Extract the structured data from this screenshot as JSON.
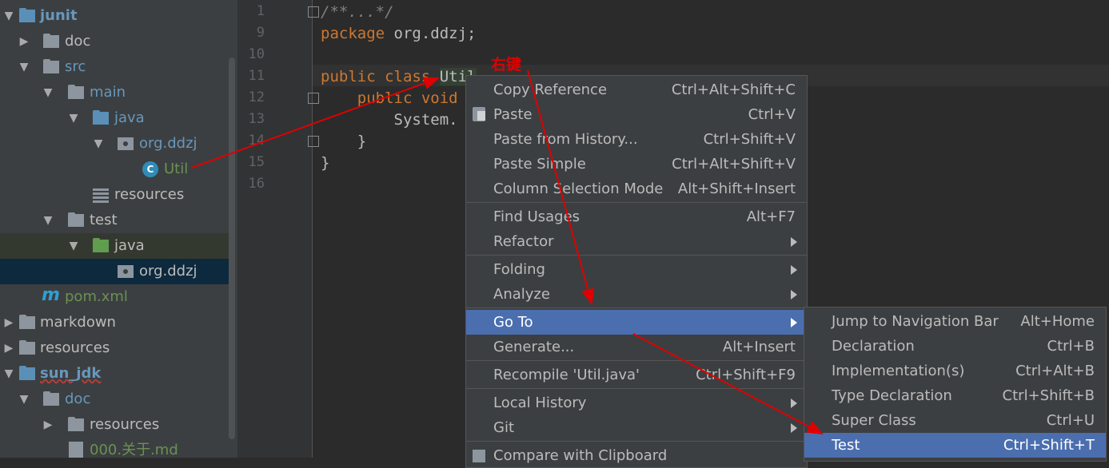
{
  "project_tree": {
    "items": [
      {
        "label": "junit",
        "icon": "folder-icon"
      },
      {
        "label": "doc",
        "icon": "folder-icon"
      },
      {
        "label": "src",
        "icon": "folder-icon"
      },
      {
        "label": "main",
        "icon": "folder-icon"
      },
      {
        "label": "java",
        "icon": "folder-icon"
      },
      {
        "label": "org.ddzj",
        "icon": "package-icon"
      },
      {
        "label": "Util",
        "icon": "class-icon"
      },
      {
        "label": "resources",
        "icon": "resources-folder-icon"
      },
      {
        "label": "test",
        "icon": "folder-icon"
      },
      {
        "label": "java",
        "icon": "folder-icon"
      },
      {
        "label": "org.ddzj",
        "icon": "package-icon"
      },
      {
        "label": "pom.xml",
        "icon": "maven-icon"
      },
      {
        "label": "markdown",
        "icon": "folder-icon"
      },
      {
        "label": "resources",
        "icon": "folder-icon"
      },
      {
        "label": "sun_jdk",
        "icon": "folder-icon"
      },
      {
        "label": "doc",
        "icon": "folder-icon"
      },
      {
        "label": "resources",
        "icon": "folder-icon"
      },
      {
        "label": "000.关于.md",
        "icon": "markdown-file-icon"
      }
    ]
  },
  "editor": {
    "line_numbers": [
      "1",
      "9",
      "10",
      "11",
      "12",
      "13",
      "14",
      "15",
      "16"
    ],
    "code": {
      "comment": "/**...*/",
      "package_kw": "package",
      "package_name": " org.ddzj;",
      "public_kw": "public",
      "class_kw": "class",
      "class_name": "Util",
      "public_void": "public void",
      "system": "System.",
      "brace_inner": "}",
      "brace_outer": "}"
    }
  },
  "annotation": {
    "text": "右键",
    "color": "#e00000"
  },
  "context_menu": {
    "items": [
      {
        "label": "Copy Reference",
        "shortcut": "Ctrl+Alt+Shift+C"
      },
      {
        "label": "Paste",
        "shortcut": "Ctrl+V",
        "icon": "paste-icon"
      },
      {
        "label": "Paste from History...",
        "shortcut": "Ctrl+Shift+V"
      },
      {
        "label": "Paste Simple",
        "shortcut": "Ctrl+Alt+Shift+V"
      },
      {
        "label": "Column Selection Mode",
        "shortcut": "Alt+Shift+Insert"
      },
      {
        "label": "Find Usages",
        "shortcut": "Alt+F7"
      },
      {
        "label": "Refactor",
        "shortcut": ""
      },
      {
        "label": "Folding",
        "shortcut": ""
      },
      {
        "label": "Analyze",
        "shortcut": ""
      },
      {
        "label": "Go To",
        "shortcut": ""
      },
      {
        "label": "Generate...",
        "shortcut": "Alt+Insert"
      },
      {
        "label": "Recompile 'Util.java'",
        "shortcut": "Ctrl+Shift+F9"
      },
      {
        "label": "Local History",
        "shortcut": ""
      },
      {
        "label": "Git",
        "shortcut": ""
      },
      {
        "label": "Compare with Clipboard",
        "shortcut": "",
        "icon": "compare-icon"
      }
    ]
  },
  "goto_submenu": {
    "items": [
      {
        "label": "Jump to Navigation Bar",
        "shortcut": "Alt+Home"
      },
      {
        "label": "Declaration",
        "shortcut": "Ctrl+B"
      },
      {
        "label": "Implementation(s)",
        "shortcut": "Ctrl+Alt+B"
      },
      {
        "label": "Type Declaration",
        "shortcut": "Ctrl+Shift+B"
      },
      {
        "label": "Super Class",
        "shortcut": "Ctrl+U"
      },
      {
        "label": "Test",
        "shortcut": "Ctrl+Shift+T"
      }
    ]
  },
  "colors": {
    "menu_highlight": "#4b6eaf",
    "menu_bg": "#3c3f41",
    "editor_bg": "#2b2b2b",
    "keyword": "#cc7832",
    "arrow": "#e00000"
  }
}
